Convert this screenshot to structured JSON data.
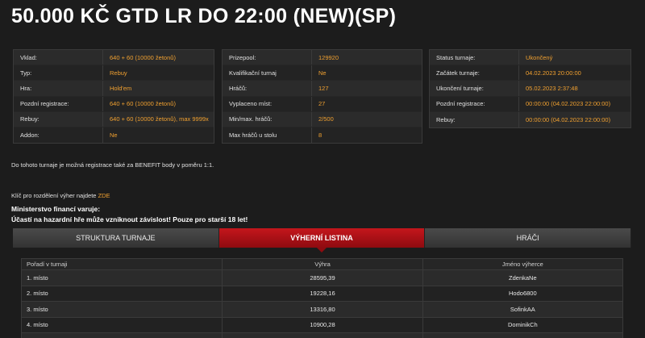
{
  "title": "50.000 KČ GTD LR DO 22:00 (NEW)(SP)",
  "colors": {
    "accent": "#f0a030",
    "active_tab": "#c4161c",
    "background": "#1c1c1c"
  },
  "table_left": [
    {
      "label": "Vklad:",
      "value": "640 + 60 (10000 žetonů)"
    },
    {
      "label": "Typ:",
      "value": "Rebuy"
    },
    {
      "label": "Hra:",
      "value": "Hold'em"
    },
    {
      "label": "Pozdní registrace:",
      "value": "640 + 60 (10000 žetonů)"
    },
    {
      "label": "Rebuy:",
      "value": "640 + 60 (10000 žetonů), max 9999x"
    },
    {
      "label": "Addon:",
      "value": "Ne"
    }
  ],
  "table_mid": [
    {
      "label": "Prizepool:",
      "value": "129920"
    },
    {
      "label": "Kvalifikační turnaj",
      "value": "Ne"
    },
    {
      "label": "Hráčů:",
      "value": "127"
    },
    {
      "label": "Vyplaceno míst:",
      "value": "27"
    },
    {
      "label": "Min/max. hráčů:",
      "value": "2/500"
    },
    {
      "label": "Max hráčů u stolu",
      "value": "8"
    }
  ],
  "table_right": [
    {
      "label": "Status turnaje:",
      "value": "Ukončený"
    },
    {
      "label": "Začátek turnaje:",
      "value": "04.02.2023 20:00:00"
    },
    {
      "label": "Ukončení turnaje:",
      "value": "05.02.2023 2:37:48"
    },
    {
      "label": "Pozdní registrace:",
      "value": "00:00:00 (04.02.2023 22:00:00)"
    },
    {
      "label": "Rebuy:",
      "value": "00:00:00 (04.02.2023 22:00:00)"
    }
  ],
  "benefit_note": "Do tohoto turnaje je možná registrace také za BENEFIT body v poměru 1:1.",
  "key_note": {
    "text": "Klíč pro rozdělení výher najdete ",
    "link": "ZDE"
  },
  "warning": {
    "line1": "Ministerstvo financí varuje:",
    "line2": "Účastí na hazardní hře může vzniknout závislost! Pouze pro starší 18 let!"
  },
  "tabs": [
    {
      "label": "STRUKTURA TURNAJE",
      "active": false
    },
    {
      "label": "VÝHERNÍ LISTINA",
      "active": true
    },
    {
      "label": "HRÁČI",
      "active": false
    }
  ],
  "results": {
    "headers": [
      "Pořadí v turnaji",
      "Výhra",
      "Jméno výherce"
    ],
    "rows": [
      [
        "1. místo",
        "28595,39",
        "ZdenkaNe"
      ],
      [
        "2. místo",
        "19228,16",
        "Hodo6800"
      ],
      [
        "3. místo",
        "13316,80",
        "SofinkAA"
      ],
      [
        "4. místo",
        "10900,28",
        "DominikCh"
      ],
      [
        "5. místo",
        "",
        ""
      ]
    ]
  }
}
